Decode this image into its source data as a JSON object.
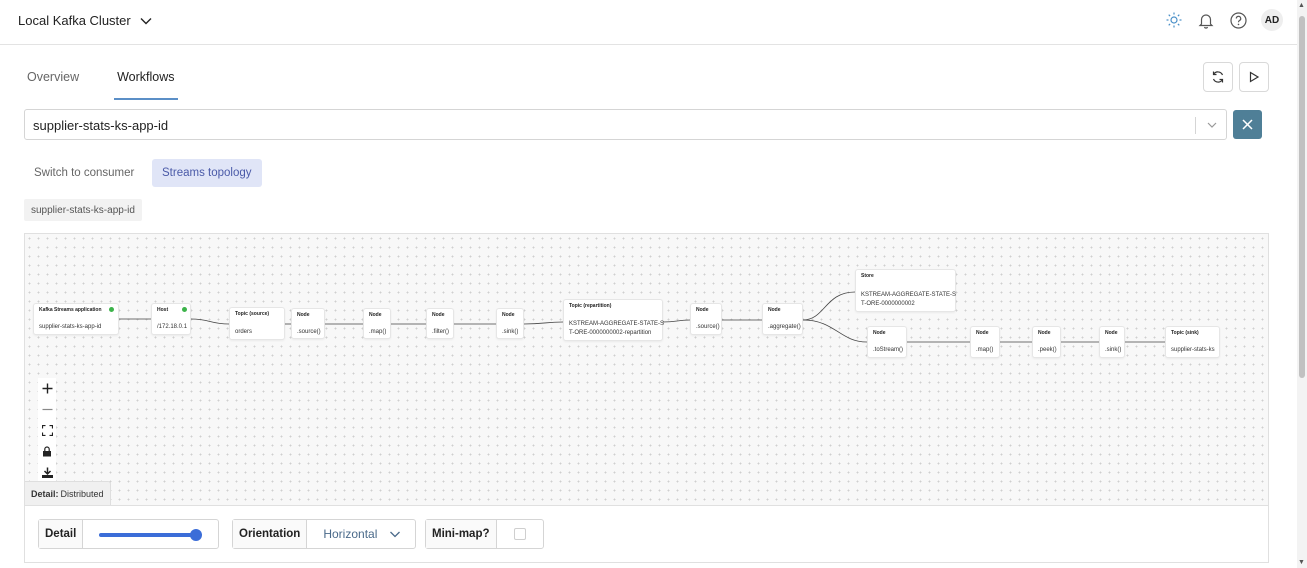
{
  "header": {
    "cluster_name": "Local Kafka Cluster",
    "icons": [
      "sun-icon",
      "bell-icon",
      "help-icon"
    ],
    "avatar_initials": "AD"
  },
  "tabs": [
    {
      "label": "Overview",
      "active": false
    },
    {
      "label": "Workflows",
      "active": true
    }
  ],
  "actions": {
    "refresh_icon": "refresh-icon",
    "run_icon": "play-icon"
  },
  "app_select": {
    "value": "supplier-stats-ks-app-id"
  },
  "mode_buttons": {
    "consumer": "Switch to consumer",
    "streams": "Streams topology"
  },
  "app_chip": "supplier-stats-ks-app-id",
  "graph": {
    "nodes": {
      "app": {
        "header": "Kafka Streams application",
        "body": "supplier-stats-ks-app-id"
      },
      "host": {
        "header": "Host",
        "body": "/172.18.0.1"
      },
      "topic_source": {
        "header": "Topic (source)",
        "body": "orders"
      },
      "n1": {
        "header": "Node",
        "body": ".source()"
      },
      "n2": {
        "header": "Node",
        "body": ".map()"
      },
      "n3": {
        "header": "Node",
        "body": ".filter()"
      },
      "n4": {
        "header": "Node",
        "body": ".sink()"
      },
      "topic_repartition": {
        "header": "Topic (repartition)",
        "body1": "KSTREAM-AGGREGATE-STATE-S",
        "body2": "T-ORE-0000000002-repartition"
      },
      "n5": {
        "header": "Node",
        "body": ".source()"
      },
      "n6": {
        "header": "Node",
        "body": ".aggregate()"
      },
      "store": {
        "header": "Store",
        "body1": "KSTREAM-AGGREGATE-STATE-S",
        "body2": "T-ORE-0000000002"
      },
      "n7": {
        "header": "Node",
        "body": ".toStream()"
      },
      "n8": {
        "header": "Node",
        "body": ".map()"
      },
      "n9": {
        "header": "Node",
        "body": ".peek()"
      },
      "n10": {
        "header": "Node",
        "body": ".sink()"
      },
      "topic_sink": {
        "header": "Topic (sink)",
        "body": "supplier-stats-ks"
      }
    }
  },
  "detail_tag": {
    "label": "Detail:",
    "value": "Distributed"
  },
  "settings": {
    "detail_label": "Detail",
    "detail_level": 1.0,
    "orientation_label": "Orientation",
    "orientation_value": "Horizontal",
    "minimap_label": "Mini-map?",
    "minimap_checked": false
  }
}
